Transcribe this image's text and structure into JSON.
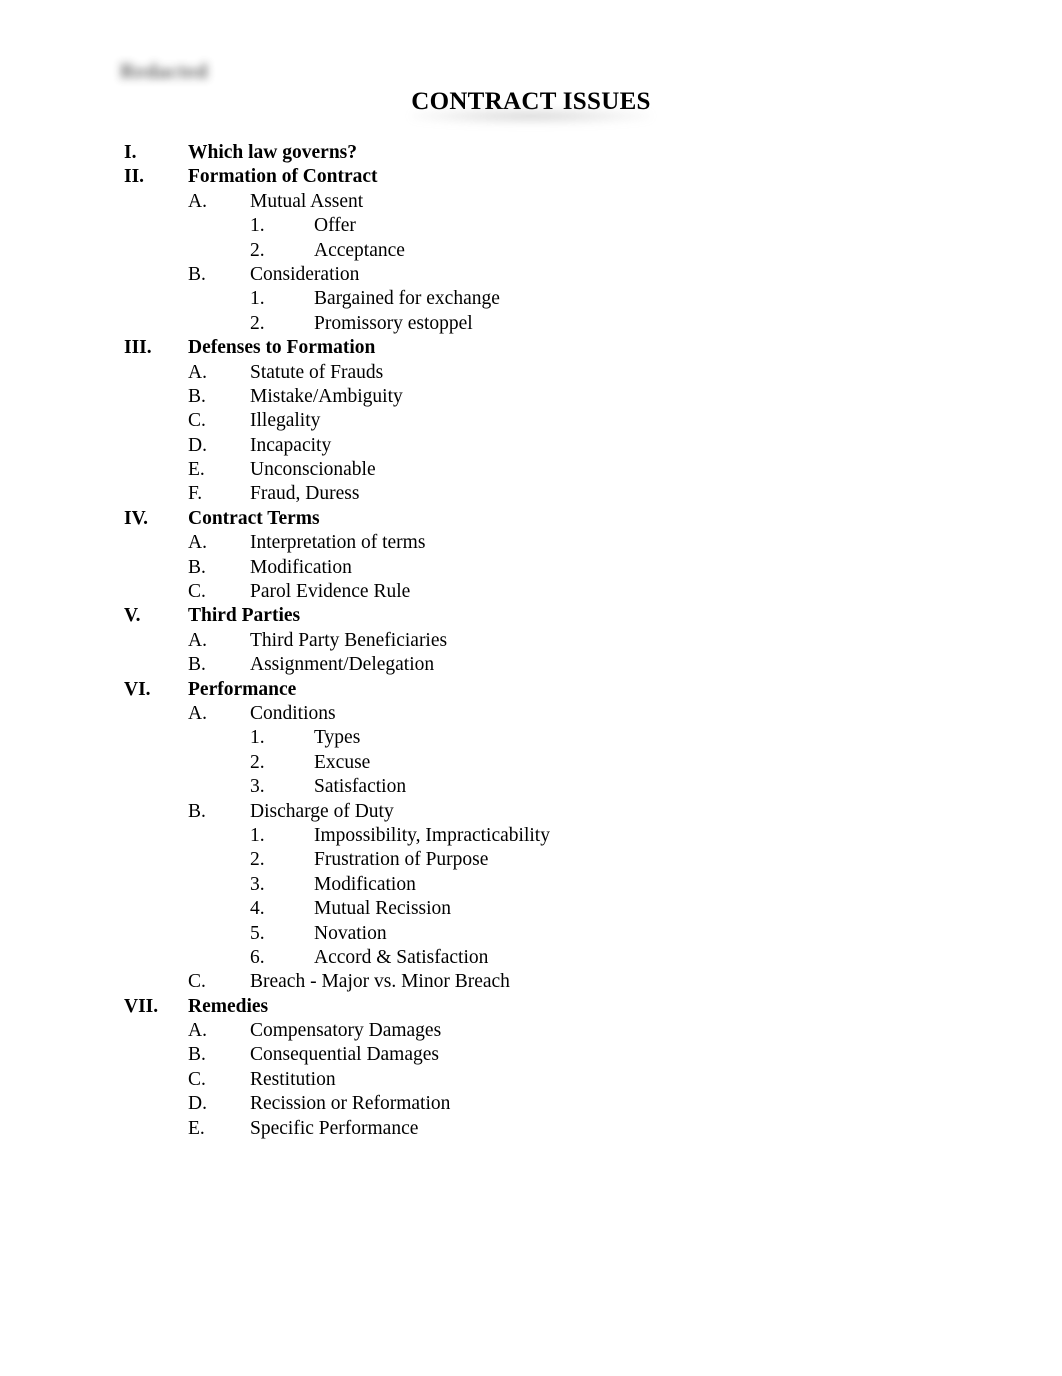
{
  "document": {
    "title": "CONTRACT ISSUES",
    "header_mark": "Redacted",
    "background_color": "#ffffff",
    "text_color": "#000000"
  },
  "outline": [
    {
      "marker": "I.",
      "label": "Which law governs?",
      "children": []
    },
    {
      "marker": "II.",
      "label": "Formation of Contract",
      "children": [
        {
          "marker": "A.",
          "label": "Mutual Assent",
          "children": [
            {
              "marker": "1.",
              "label": "Offer"
            },
            {
              "marker": "2.",
              "label": "Acceptance"
            }
          ]
        },
        {
          "marker": "B.",
          "label": "Consideration",
          "children": [
            {
              "marker": "1.",
              "label": "Bargained for exchange"
            },
            {
              "marker": "2.",
              "label": "Promissory estoppel"
            }
          ]
        }
      ]
    },
    {
      "marker": "III.",
      "label": "Defenses to Formation",
      "children": [
        {
          "marker": "A.",
          "label": "Statute of Frauds",
          "children": []
        },
        {
          "marker": "B.",
          "label": "Mistake/Ambiguity",
          "children": []
        },
        {
          "marker": "C.",
          "label": "Illegality",
          "children": []
        },
        {
          "marker": "D.",
          "label": "Incapacity",
          "children": []
        },
        {
          "marker": "E.",
          "label": "Unconscionable",
          "children": []
        },
        {
          "marker": "F.",
          "label": "Fraud, Duress",
          "children": []
        }
      ]
    },
    {
      "marker": "IV.",
      "label": "Contract Terms",
      "children": [
        {
          "marker": "A.",
          "label": "Interpretation of terms",
          "children": []
        },
        {
          "marker": "B.",
          "label": "Modification",
          "children": []
        },
        {
          "marker": "C.",
          "label": "Parol Evidence Rule",
          "children": []
        }
      ]
    },
    {
      "marker": "V.",
      "label": "Third Parties",
      "children": [
        {
          "marker": "A.",
          "label": "Third Party Beneficiaries",
          "children": []
        },
        {
          "marker": "B.",
          "label": "Assignment/Delegation",
          "children": []
        }
      ]
    },
    {
      "marker": "VI.",
      "label": "Performance",
      "children": [
        {
          "marker": "A.",
          "label": "Conditions",
          "children": [
            {
              "marker": "1.",
              "label": "Types"
            },
            {
              "marker": "2.",
              "label": "Excuse"
            },
            {
              "marker": "3.",
              "label": "Satisfaction"
            }
          ]
        },
        {
          "marker": "B.",
          "label": "Discharge of Duty",
          "children": [
            {
              "marker": "1.",
              "label": "Impossibility, Impracticability"
            },
            {
              "marker": "2.",
              "label": "Frustration of Purpose"
            },
            {
              "marker": "3.",
              "label": "Modification"
            },
            {
              "marker": "4.",
              "label": "Mutual Recission"
            },
            {
              "marker": "5.",
              "label": "Novation"
            },
            {
              "marker": "6.",
              "label": "Accord & Satisfaction"
            }
          ]
        },
        {
          "marker": "C.",
          "label": "Breach - Major vs. Minor Breach",
          "children": []
        }
      ]
    },
    {
      "marker": "VII.",
      "label": "Remedies",
      "children": [
        {
          "marker": "A.",
          "label": "Compensatory Damages",
          "children": []
        },
        {
          "marker": "B.",
          "label": "Consequential Damages",
          "children": []
        },
        {
          "marker": "C.",
          "label": "Restitution",
          "children": []
        },
        {
          "marker": "D.",
          "label": "Recission or Reformation",
          "children": []
        },
        {
          "marker": "E.",
          "label": "Specific Performance",
          "children": []
        }
      ]
    }
  ]
}
